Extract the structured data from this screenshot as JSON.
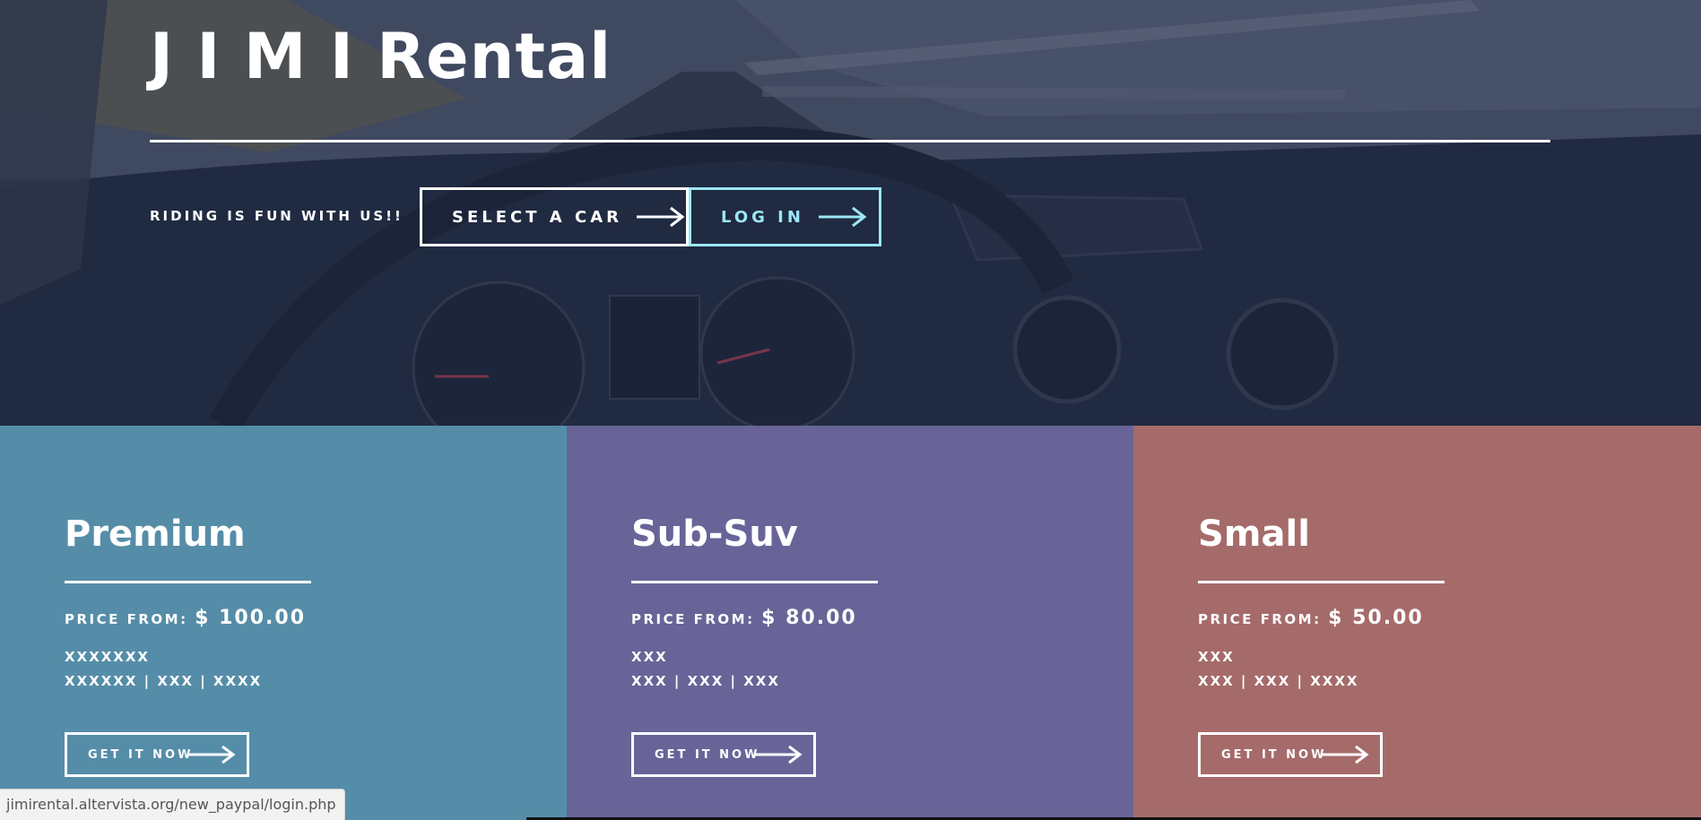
{
  "hero": {
    "title": "J I M I Rental",
    "tagline": "RIDING IS FUN WITH US!!",
    "select_label": "SELECT A CAR",
    "login_label": "LOG IN"
  },
  "cards": [
    {
      "title": "Premium",
      "price_label": "PRICE FROM:",
      "price": "$ 100.00",
      "spec1": "XXXXXXX",
      "spec2": "XXXXXX | XXX | XXXX",
      "button_label": "GET IT NOW",
      "color": "#558da8"
    },
    {
      "title": "Sub-Suv",
      "price_label": "PRICE FROM:",
      "price": "$ 80.00",
      "spec1": "XXX",
      "spec2": "XXX | XXX | XXX",
      "button_label": "GET IT NOW",
      "color": "#686498"
    },
    {
      "title": "Small",
      "price_label": "PRICE FROM:",
      "price": "$ 50.00",
      "spec1": "XXX",
      "spec2": "XXX | XXX | XXXX",
      "button_label": "GET IT NOW",
      "color": "#a56b6a"
    }
  ],
  "status_bar": {
    "url": "jimirental.altervista.org/new_paypal/login.php"
  },
  "colors": {
    "hero_overlay": "#1e2842",
    "login_accent": "#9be7f5",
    "text": "#ffffff"
  }
}
